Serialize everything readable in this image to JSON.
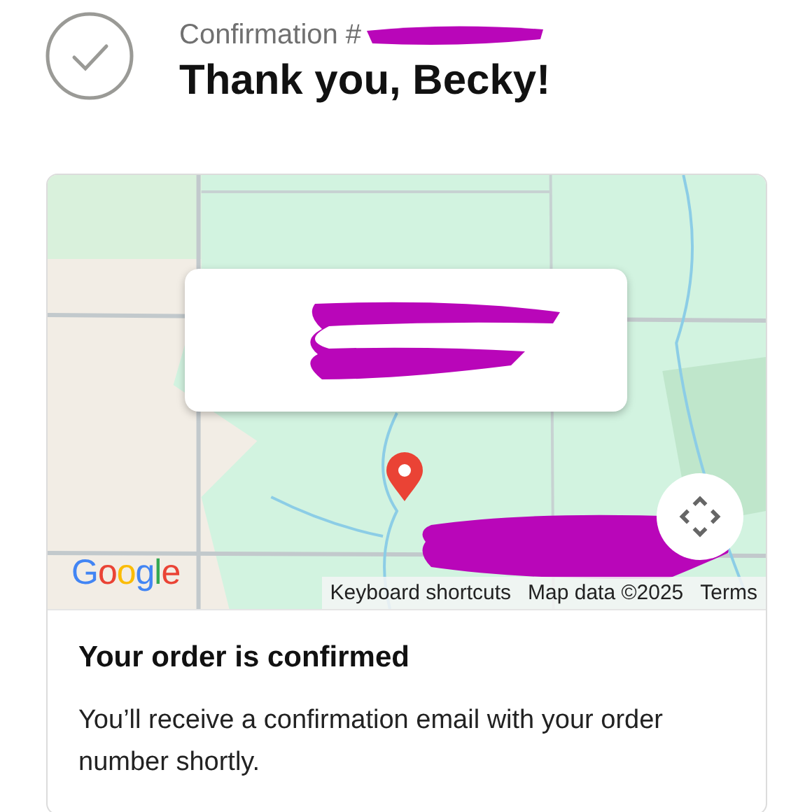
{
  "header": {
    "confirmation_label": "Confirmation #",
    "title": "Thank you, Becky!"
  },
  "map": {
    "logo": "Google",
    "attribution": [
      "Keyboard shortcuts",
      "Map data ©2025",
      "Terms"
    ]
  },
  "order_status": {
    "heading": "Your order is confirmed",
    "message": "You’ll receive a confirmation email with your order number shortly."
  }
}
